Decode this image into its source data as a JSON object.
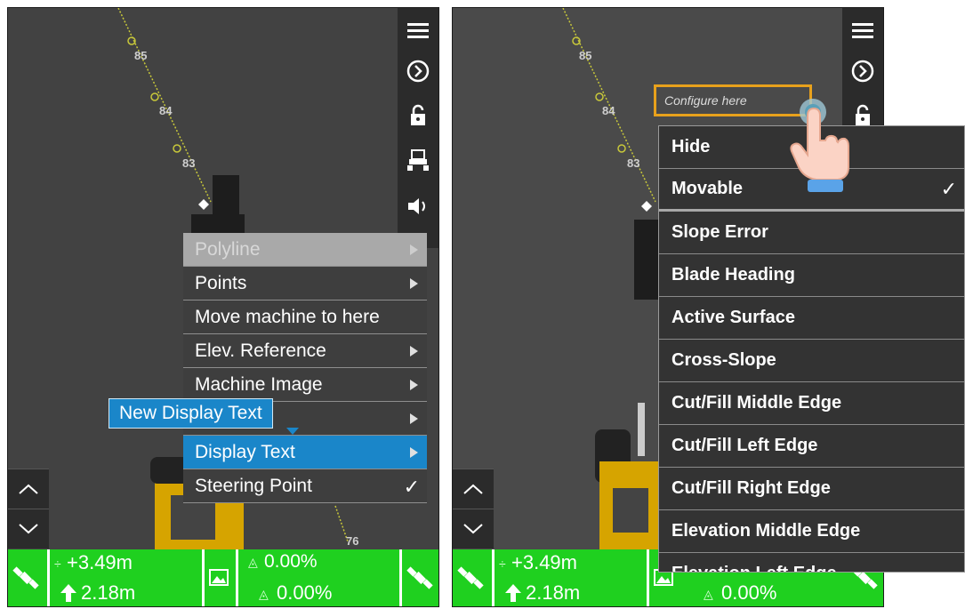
{
  "left_panel": {
    "toolbar_icons": [
      "menu-icon",
      "forward-circle-icon",
      "lock-icon",
      "machine-icon",
      "speaker-icon"
    ],
    "stations": [
      "85",
      "84",
      "83",
      "76"
    ],
    "context_menu": [
      {
        "label": "Polyline",
        "state": "disabled",
        "submenu": true
      },
      {
        "label": "Points",
        "state": "normal",
        "submenu": true
      },
      {
        "label": "Move machine to here",
        "state": "normal",
        "submenu": false
      },
      {
        "label": "Elev. Reference",
        "state": "normal",
        "submenu": true
      },
      {
        "label": "Machine Image",
        "state": "normal",
        "submenu": true
      },
      {
        "label": "",
        "state": "normal",
        "submenu": true
      },
      {
        "label": "Display Text",
        "state": "selected",
        "submenu": true
      },
      {
        "label": "Steering Point",
        "state": "normal",
        "submenu": false,
        "checked": true
      }
    ],
    "tooltip": "New Display Text",
    "status_bar": {
      "cut_fill": "+3.49m",
      "elevation": "2.18m",
      "slope_top": "0.00%",
      "slope_bottom": "0.00%"
    }
  },
  "right_panel": {
    "toolbar_icons": [
      "menu-icon",
      "forward-circle-icon",
      "lock-icon"
    ],
    "stations": [
      "85",
      "84",
      "83"
    ],
    "configure_text": "Configure here",
    "display_menu": [
      {
        "label": "Hide",
        "checked": false
      },
      {
        "label": "Movable",
        "checked": true
      },
      {
        "label": "Slope Error"
      },
      {
        "label": "Blade Heading"
      },
      {
        "label": "Active Surface"
      },
      {
        "label": "Cross-Slope"
      },
      {
        "label": "Cut/Fill Middle Edge"
      },
      {
        "label": "Cut/Fill Left Edge"
      },
      {
        "label": "Cut/Fill Right Edge"
      },
      {
        "label": "Elevation Middle Edge"
      },
      {
        "label": "Elevation Left Edge"
      }
    ],
    "status_bar": {
      "cut_fill": "+3.49m",
      "elevation": "2.18m",
      "slope_bottom": "0.00%"
    }
  },
  "colors": {
    "status_green": "#1fd01f",
    "menu_blue": "#1a86c9",
    "highlight_orange": "#e8a11c",
    "map_gray": "#424242"
  },
  "check_mark": "✓"
}
